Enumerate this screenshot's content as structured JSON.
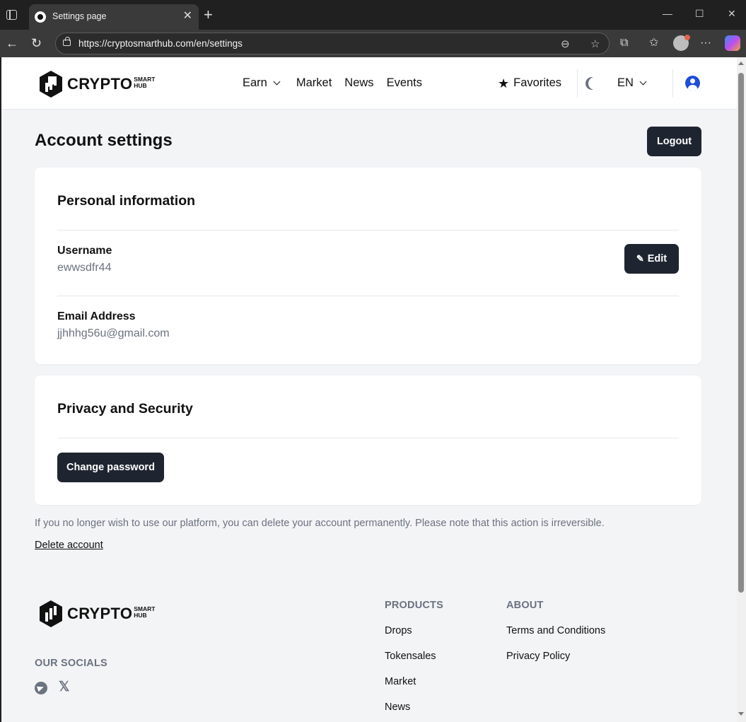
{
  "browser": {
    "tab_title": "Settings page",
    "url": "https://cryptosmarthub.com/en/settings",
    "tab_close": "✕",
    "new_tab": "+",
    "win_min": "—",
    "win_max": "☐",
    "win_close": "✕",
    "back": "←",
    "refresh": "↻",
    "reader": "⊖",
    "fav": "☆",
    "extensions": "⧉",
    "favorites_bar": "✩",
    "more": "···"
  },
  "header": {
    "logo_word": "CRYPTO",
    "logo_sub_1": "SMART",
    "logo_sub_2": "HUB",
    "nav": {
      "earn": "Earn",
      "market": "Market",
      "news": "News",
      "events": "Events"
    },
    "favorites": "Favorites",
    "star": "★",
    "language": "EN"
  },
  "page": {
    "title": "Account settings",
    "logout": "Logout"
  },
  "personal": {
    "title": "Personal information",
    "username_label": "Username",
    "username_value": "ewwsdfr44",
    "edit": "Edit",
    "edit_icon": "✎",
    "email_label": "Email Address",
    "email_value": "jjhhhg56u@gmail.com"
  },
  "security": {
    "title": "Privacy and Security",
    "change_password": "Change password"
  },
  "delete": {
    "note": "If you no longer wish to use our platform, you can delete your account permanently. Please note that this action is irreversible.",
    "link": "Delete account"
  },
  "footer": {
    "socials_heading": "OUR SOCIALS",
    "x_glyph": "𝕏",
    "products_heading": "PRODUCTS",
    "products": [
      "Drops",
      "Tokensales",
      "Market",
      "News"
    ],
    "about_heading": "ABOUT",
    "about": [
      "Terms and Conditions",
      "Privacy Policy"
    ]
  }
}
